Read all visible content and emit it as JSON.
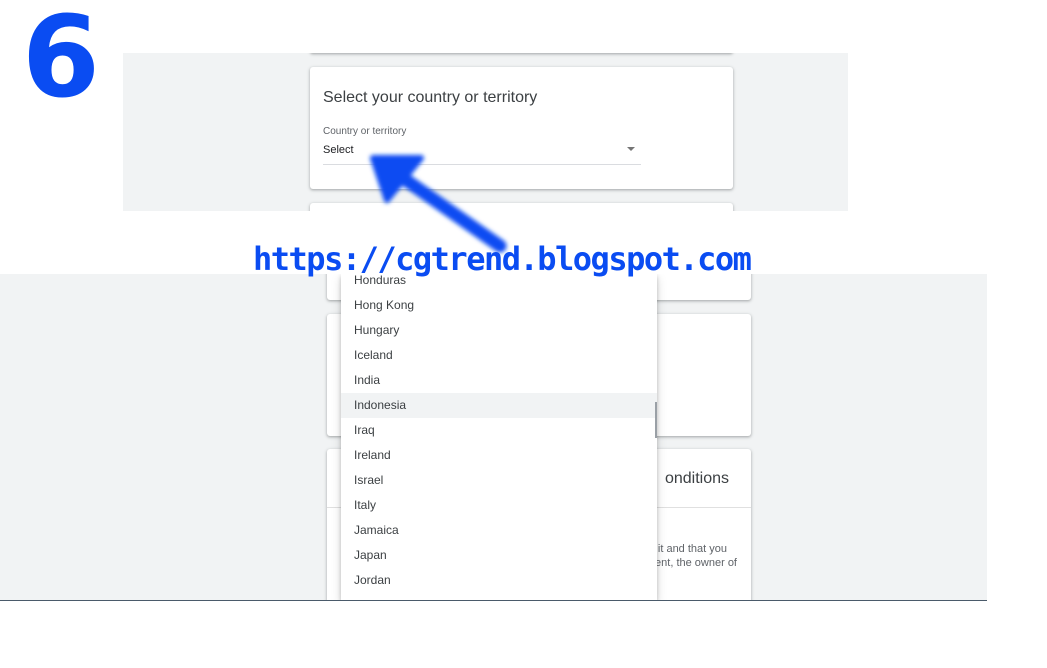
{
  "step_number": "6",
  "website_url": "https://cgtrend.blogspot.com",
  "country_card": {
    "title": "Select your country or territory",
    "field_label": "Country or territory",
    "select_value": "Select"
  },
  "terms_card": {
    "title_fragment": "onditions",
    "line_1": "it and that you",
    "line_2": "ent, the owner of"
  },
  "dropdown": {
    "partial_top": "Honduras",
    "items": [
      "Hong Kong",
      "Hungary",
      "Iceland",
      "India",
      "Indonesia",
      "Iraq",
      "Ireland",
      "Israel",
      "Italy",
      "Jamaica",
      "Japan",
      "Jordan"
    ],
    "highlighted": "Indonesia"
  },
  "colors": {
    "annotation_blue": "#0a4cf2",
    "page_gray": "#f1f3f4"
  },
  "icons": [
    "arrow-annotation-icon",
    "dropdown-caret-icon"
  ]
}
